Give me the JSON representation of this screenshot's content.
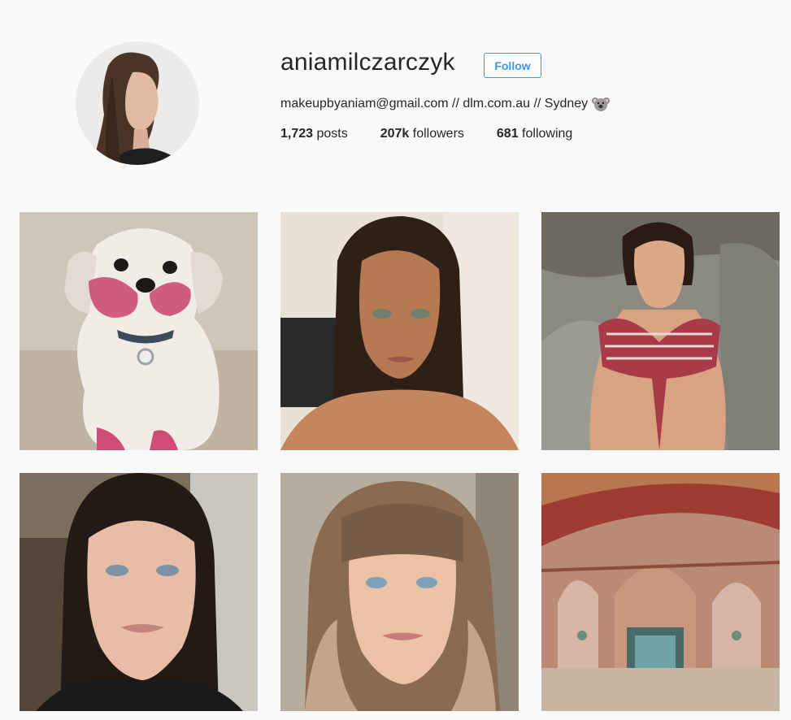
{
  "profile": {
    "username": "aniamilczarczyk",
    "follow_label": "Follow",
    "bio_text": "makeupbyaniam@gmail.com // dlm.com.au // Sydney",
    "bio_icon": "koala-icon",
    "stats": {
      "posts_count": "1,723",
      "posts_label": " posts",
      "followers_count": "207k",
      "followers_label": " followers",
      "following_count": "681",
      "following_label": " following"
    }
  },
  "colors": {
    "background": "#fafafa",
    "accent": "#3897f0",
    "text": "#262626"
  },
  "posts": [
    {
      "subject": "white shih tzu dog with pink lipstick marks"
    },
    {
      "subject": "woman with wet slicked-back hair"
    },
    {
      "subject": "woman in red striped tie-front top on rocks"
    },
    {
      "subject": "woman with sleek dark hair close-up"
    },
    {
      "subject": "woman with bangs and wavy hair"
    },
    {
      "subject": "ornate painted palace interior"
    }
  ]
}
